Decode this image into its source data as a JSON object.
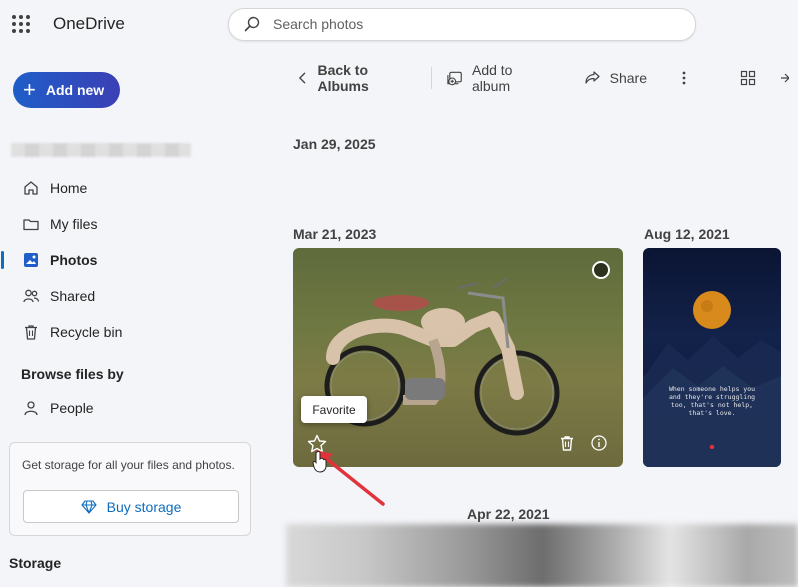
{
  "header": {
    "app_name": "OneDrive",
    "search_placeholder": "Search photos"
  },
  "sidebar": {
    "add_new_label": "Add new",
    "nav": [
      {
        "label": "Home",
        "icon": "home-icon"
      },
      {
        "label": "My files",
        "icon": "folder-icon"
      },
      {
        "label": "Photos",
        "icon": "photos-icon",
        "active": true
      },
      {
        "label": "Shared",
        "icon": "people-icon"
      },
      {
        "label": "Recycle bin",
        "icon": "trash-icon"
      }
    ],
    "browse_title": "Browse files by",
    "browse_items": [
      {
        "label": "People",
        "icon": "person-icon"
      }
    ],
    "storage_promo": "Get storage for all your files and photos.",
    "buy_storage_label": "Buy storage",
    "storage_heading": "Storage"
  },
  "toolbar": {
    "back_label": "Back to Albums",
    "add_to_album_label": "Add to album",
    "share_label": "Share"
  },
  "content": {
    "groups": [
      {
        "date": "Jan 29, 2025"
      },
      {
        "date": "Mar 21, 2023"
      },
      {
        "date": "Aug 12, 2021"
      },
      {
        "date": "Apr 22, 2021"
      }
    ],
    "tooltip": "Favorite",
    "moon_caption": "When someone helps you\nand they're struggling\ntoo, that's not help,\nthat's love."
  },
  "colors": {
    "accent": "#0f6cbd",
    "add_new_gradient_start": "#1f5ec8",
    "add_new_gradient_end": "#3b3fb5",
    "annotation_arrow": "#e0333b"
  }
}
